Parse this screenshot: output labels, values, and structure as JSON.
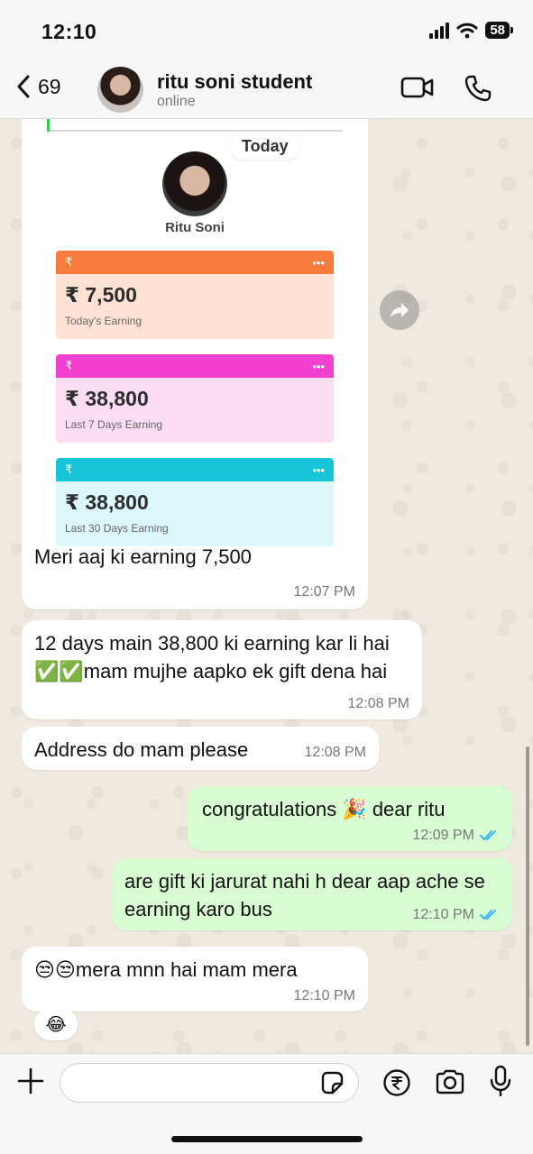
{
  "status_bar": {
    "time": "12:10",
    "battery": "58"
  },
  "header": {
    "back_count": "69",
    "contact_name": "ritu soni student",
    "contact_status": "online"
  },
  "shared_image": {
    "profile_name": "Ritu Soni",
    "cards": [
      {
        "strip_symbol": "₹",
        "strip_menu": "•••",
        "amount": "₹ 7,500",
        "label": "Today's Earning",
        "strip_color": "#f97b3d",
        "bg_color": "#fde2d3"
      },
      {
        "strip_symbol": "₹",
        "strip_menu": "•••",
        "amount": "₹ 38,800",
        "label": "Last 7 Days Earning",
        "strip_color": "#f23fd0",
        "bg_color": "#fbdcf3"
      },
      {
        "strip_symbol": "₹",
        "strip_menu": "•••",
        "amount": "₹ 38,800",
        "label": "Last 30 Days Earning",
        "strip_color": "#18c4d9",
        "bg_color": "#dbf7fa"
      }
    ]
  },
  "date_pill": "Today",
  "messages": [
    {
      "text": "Meri aaj ki earning 7,500",
      "time": "12:07 PM"
    },
    {
      "text": "12 days main 38,800 ki earning kar li hai ✅✅mam mujhe aapko ek gift dena hai",
      "time": "12:08 PM"
    },
    {
      "text": "Address do mam please",
      "time": "12:08 PM"
    },
    {
      "text": "congratulations 🎉 dear ritu",
      "time": "12:09 PM"
    },
    {
      "text": "are gift ki jarurat nahi h dear aap ache se earning karo bus",
      "time": "12:10 PM"
    },
    {
      "text": "😒😒mera mnn hai mam mera",
      "time": "12:10 PM"
    }
  ],
  "reaction": "😂",
  "input": {
    "value": ""
  },
  "colors": {
    "outgoing_bubble": "#d9fdd3",
    "incoming_bubble": "#ffffff",
    "read_ticks": "#34b7f1",
    "chat_bg": "#efe9df"
  }
}
